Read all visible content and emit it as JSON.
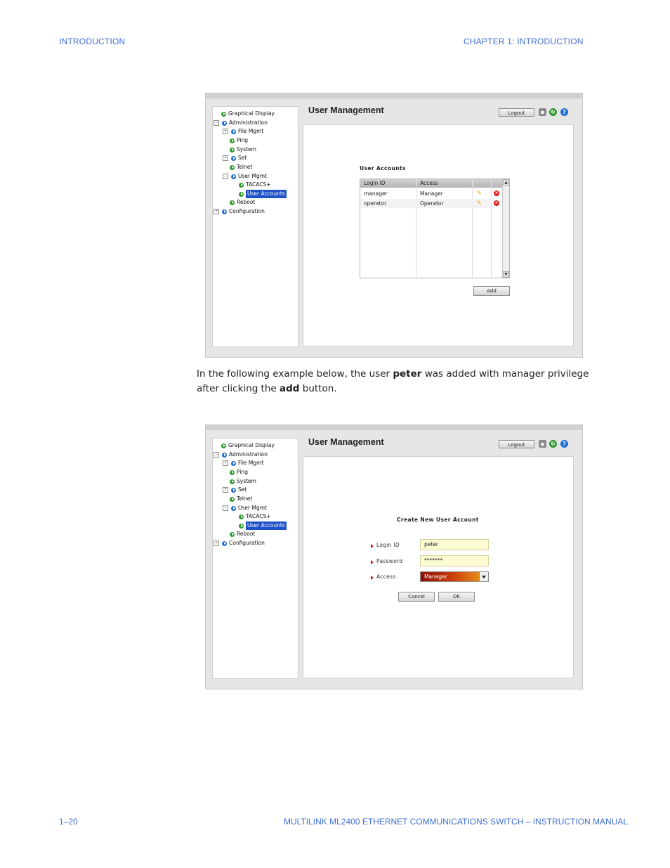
{
  "header": {
    "left": "INTRODUCTION",
    "right": "CHAPTER 1: INTRODUCTION"
  },
  "footer": {
    "left": "1–20",
    "right": "MULTILINK ML2400 ETHERNET COMMUNICATIONS SWITCH – INSTRUCTION MANUAL"
  },
  "paragraph": {
    "p1": "In the following example below, the user ",
    "b1": "peter",
    "p2": " was added with manager privilege after clicking the ",
    "b2": "add",
    "p3": " button."
  },
  "tree": {
    "graphical_display": "Graphical Display",
    "administration": "Administration",
    "file_mgmt": "File Mgmt",
    "ping": "Ping",
    "system": "System",
    "set": "Set",
    "telnet": "Telnet",
    "user_mgmt": "User Mgmt",
    "tacacs": "TACACS+",
    "user_accounts": "User Accounts",
    "reboot": "Reboot",
    "configuration": "Configuration"
  },
  "window": {
    "title": "User Management",
    "logout": "Logout"
  },
  "accounts": {
    "section_title": "User Accounts",
    "columns": [
      "Login ID",
      "Access"
    ],
    "rows": [
      {
        "login": "manager",
        "access": "Manager"
      },
      {
        "login": "operator",
        "access": "Operator"
      }
    ],
    "add_button": "Add"
  },
  "create": {
    "section_title": "Create New User Account",
    "login_label": "Login ID",
    "login_value": "peter",
    "password_label": "Password",
    "password_value": "*******",
    "access_label": "Access",
    "access_value": "Manager",
    "cancel_button": "Cancel",
    "ok_button": "OK"
  },
  "colors": {
    "accent_text": "#3f6fd8",
    "selection": "#1f52c8"
  }
}
